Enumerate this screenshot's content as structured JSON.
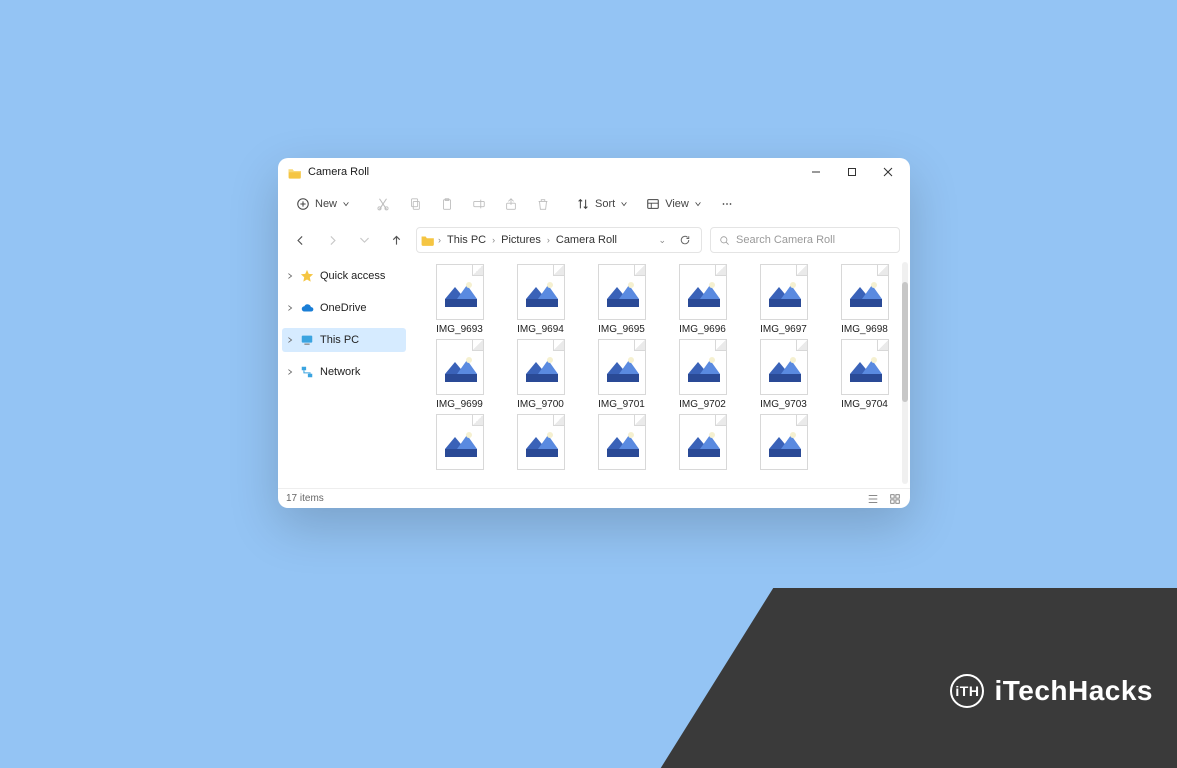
{
  "window": {
    "title": "Camera Roll"
  },
  "toolbar": {
    "new_label": "New",
    "sort_label": "Sort",
    "view_label": "View"
  },
  "breadcrumb": {
    "items": [
      "This PC",
      "Pictures",
      "Camera Roll"
    ]
  },
  "search": {
    "placeholder": "Search Camera Roll"
  },
  "sidebar": {
    "items": [
      {
        "label": "Quick access",
        "icon": "star"
      },
      {
        "label": "OneDrive",
        "icon": "cloud"
      },
      {
        "label": "This PC",
        "icon": "pc",
        "selected": true
      },
      {
        "label": "Network",
        "icon": "network"
      }
    ]
  },
  "files": {
    "items": [
      "IMG_9693",
      "IMG_9694",
      "IMG_9695",
      "IMG_9696",
      "IMG_9697",
      "IMG_9698",
      "IMG_9699",
      "IMG_9700",
      "IMG_9701",
      "IMG_9702",
      "IMG_9703",
      "IMG_9704",
      "",
      "",
      "",
      "",
      ""
    ]
  },
  "status": {
    "count_text": "17 items"
  },
  "brand": {
    "text": "iTechHacks",
    "logo_text": "iTH"
  }
}
